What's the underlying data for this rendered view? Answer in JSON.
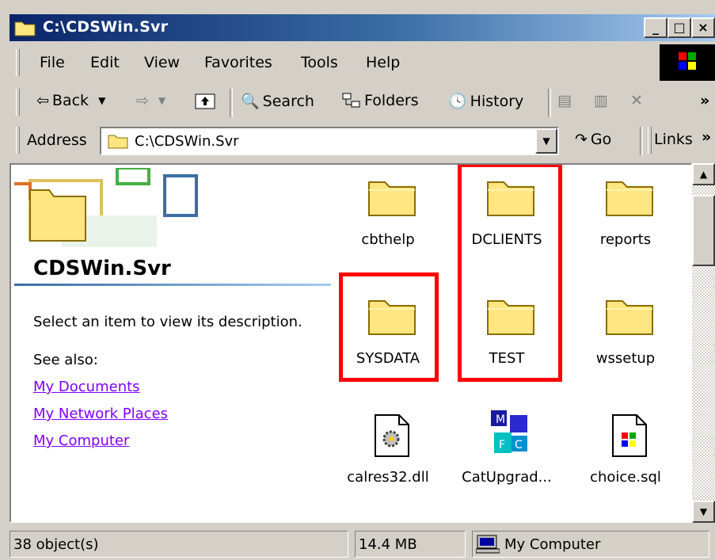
{
  "window": {
    "title": "C:\\CDSWin.Svr",
    "buttons": {
      "minimize": "_",
      "maximize": "□",
      "close": "×"
    }
  },
  "menu": {
    "items": [
      {
        "label": "File"
      },
      {
        "label": "Edit"
      },
      {
        "label": "View"
      },
      {
        "label": "Favorites"
      },
      {
        "label": "Tools"
      },
      {
        "label": "Help"
      }
    ]
  },
  "toolbar": {
    "back": "Back",
    "search": "Search",
    "folders": "Folders",
    "history": "History",
    "more": "»"
  },
  "address": {
    "label": "Address",
    "value": "C:\\CDSWin.Svr",
    "go": "Go",
    "links": "Links",
    "more": "»"
  },
  "panel": {
    "title": "CDSWin.Svr",
    "description": "Select an item to view its description.",
    "see_also": "See also:",
    "links": [
      "My Documents",
      "My Network Places",
      "My Computer"
    ]
  },
  "items": [
    {
      "label": "cbthelp",
      "type": "folder"
    },
    {
      "label": "DCLIENTS",
      "type": "folder",
      "highlighted": true
    },
    {
      "label": "reports",
      "type": "folder"
    },
    {
      "label": "SYSDATA",
      "type": "folder",
      "highlighted": true
    },
    {
      "label": "TEST",
      "type": "folder",
      "highlighted": true
    },
    {
      "label": "wssetup",
      "type": "folder"
    },
    {
      "label": "calres32.dll",
      "type": "dll"
    },
    {
      "label": "CatUpgrad...",
      "type": "app"
    },
    {
      "label": "choice.sql",
      "type": "sql"
    }
  ],
  "status": {
    "objects": "38 object(s)",
    "size": "14.4 MB",
    "zone": "My Computer"
  },
  "colors": {
    "title_start": "#0a246a",
    "title_end": "#a6caf0",
    "highlight": "#ff0000",
    "link": "#8000ff",
    "face": "#d4d0c8"
  }
}
